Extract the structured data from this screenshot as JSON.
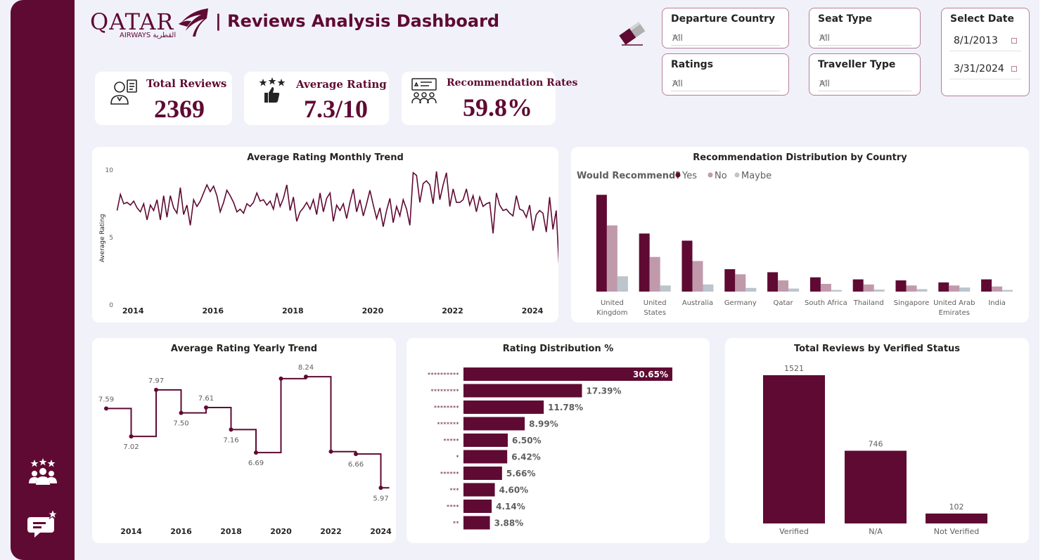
{
  "header": {
    "logo_text": "QATAR",
    "logo_sub": "AIRWAYS القطرية",
    "title": "| Reviews Analysis Dashboard"
  },
  "kpis": {
    "total_reviews": {
      "label": "Total Reviews",
      "value": "2369"
    },
    "average_rating": {
      "label": "Average Rating",
      "value": "7.3/10"
    },
    "recommendation": {
      "label": "Recommendation Rates",
      "value": "59.8%"
    }
  },
  "filters": {
    "departure_country": {
      "label": "Departure Country",
      "value": "All"
    },
    "seat_type": {
      "label": "Seat Type",
      "value": "All"
    },
    "ratings": {
      "label": "Ratings",
      "value": "All"
    },
    "traveller_type": {
      "label": "Traveller Type",
      "value": "All"
    },
    "date": {
      "label": "Select Date",
      "start": "8/1/2013",
      "end": "3/31/2024"
    }
  },
  "colors": {
    "brand": "#5f0a33",
    "no": "#c09aab",
    "maybe": "#bcc4cc",
    "background": "#f1f1f9"
  },
  "icons": [
    "users-icon",
    "star-thumb-icon",
    "recommend-board-icon",
    "eraser-icon",
    "team-stars-icon",
    "review-star-icon"
  ],
  "chart_data": [
    {
      "id": "monthly",
      "type": "line",
      "title": "Average Rating Monthly Trend",
      "ylabel": "Average Rating",
      "xlabel": "",
      "ylim": [
        0,
        10
      ],
      "yticks": [
        0,
        5,
        10
      ],
      "xticks": [
        "2014",
        "2016",
        "2018",
        "2020",
        "2022",
        "2024"
      ],
      "x_start": 2013.6,
      "x_step": 0.0833,
      "values": [
        7.0,
        8.2,
        7.5,
        7.6,
        7.4,
        7.7,
        7.2,
        6.9,
        7.5,
        6.3,
        7.4,
        7.0,
        7.8,
        6.3,
        8.1,
        6.5,
        8.1,
        7.2,
        6.8,
        8.7,
        6.7,
        7.4,
        5.9,
        7.8,
        7.3,
        7.7,
        8.3,
        8.9,
        8.4,
        8.8,
        8.1,
        6.9,
        7.6,
        8.5,
        8.1,
        7.6,
        6.9,
        7.1,
        6.8,
        7.5,
        7.3,
        7.6,
        8.3,
        7.7,
        7.8,
        7.4,
        7.7,
        7.1,
        8.3,
        7.3,
        7.9,
        8.9,
        7.0,
        8.0,
        6.2,
        6.9,
        7.2,
        7.6,
        7.1,
        7.8,
        6.7,
        8.3,
        6.9,
        7.9,
        8.3,
        6.2,
        7.4,
        7.0,
        7.5,
        6.4,
        7.6,
        8.6,
        6.9,
        7.8,
        6.6,
        7.5,
        8.5,
        7.4,
        6.4,
        7.2,
        5.8,
        7.0,
        7.9,
        6.1,
        7.3,
        6.6,
        7.8,
        7.1,
        5.9,
        9.8,
        9.6,
        7.6,
        9.0,
        9.2,
        8.9,
        7.5,
        9.9,
        7.8,
        8.9,
        9.8,
        7.3,
        8.6,
        7.6,
        7.6,
        7.8,
        8.6,
        7.4,
        8.1,
        6.9,
        8.0,
        7.3,
        7.5,
        7.6,
        5.3,
        8.3,
        7.4,
        7.0,
        7.1,
        6.8,
        6.6,
        8.1,
        7.1,
        7.0,
        6.5,
        7.4,
        5.5,
        6.7,
        7.0,
        6.8,
        5.4,
        8.0,
        5.6,
        7.0,
        2.1
      ],
      "point_markers": false
    },
    {
      "id": "country",
      "type": "bar",
      "title": "Recommendation Distribution by Country",
      "legend_title": "Would Recommend?",
      "legend_position": "top-left",
      "categories": [
        "United Kingdom",
        "United States",
        "Australia",
        "Germany",
        "Qatar",
        "South Africa",
        "Thailand",
        "Singapore",
        "United Arab Emirates",
        "India"
      ],
      "category_lines": [
        [
          "United",
          "Kingdom"
        ],
        [
          "United",
          "States"
        ],
        [
          "Australia"
        ],
        [
          "Germany"
        ],
        [
          "Qatar"
        ],
        [
          "South Africa"
        ],
        [
          "Thailand"
        ],
        [
          "Singapore"
        ],
        [
          "United Arab",
          "Emirates"
        ],
        [
          "India"
        ]
      ],
      "series": [
        {
          "name": "Yes",
          "values": [
            475,
            285,
            250,
            110,
            95,
            70,
            60,
            55,
            45,
            60
          ]
        },
        {
          "name": "No",
          "values": [
            325,
            170,
            150,
            85,
            55,
            38,
            35,
            30,
            30,
            25
          ]
        },
        {
          "name": "Maybe",
          "values": [
            75,
            30,
            35,
            18,
            15,
            8,
            10,
            12,
            20,
            8
          ]
        }
      ],
      "ylim": [
        0,
        500
      ]
    },
    {
      "id": "yearly",
      "type": "line",
      "title": "Average Rating Yearly Trend",
      "step": true,
      "x": [
        2013,
        2014,
        2015,
        2016,
        2017,
        2018,
        2019,
        2020,
        2021,
        2022,
        2023,
        2024
      ],
      "values": [
        7.59,
        7.02,
        7.97,
        7.5,
        7.61,
        7.16,
        6.69,
        8.2,
        8.24,
        6.71,
        6.66,
        5.97
      ],
      "labels": [
        "7.59",
        "7.02",
        "7.97",
        "7.50",
        "7.61",
        "7.16",
        "6.69",
        "",
        "8.24",
        "",
        "6.66",
        "5.97"
      ],
      "xticks": [
        "2014",
        "2016",
        "2018",
        "2020",
        "2022",
        "2024"
      ],
      "ylim": [
        5.5,
        8.6
      ]
    },
    {
      "id": "rating_dist",
      "type": "bar",
      "orientation": "horizontal",
      "title": "Rating Distribution %",
      "categories": [
        "**********",
        "*********",
        "********",
        "*******",
        "*****",
        "*",
        "******",
        "***",
        "****",
        "**"
      ],
      "values": [
        30.65,
        17.39,
        11.78,
        8.99,
        6.5,
        6.42,
        5.66,
        4.6,
        4.14,
        3.88
      ],
      "labels": [
        "30.65%",
        "17.39%",
        "11.78%",
        "8.99%",
        "6.50%",
        "6.42%",
        "5.66%",
        "4.60%",
        "4.14%",
        "3.88%"
      ],
      "xlim": [
        0,
        30.65
      ]
    },
    {
      "id": "verified",
      "type": "bar",
      "title": "Total Reviews by Verified Status",
      "categories": [
        "Verified",
        "N/A",
        "Not Verified"
      ],
      "values": [
        1521,
        746,
        102
      ],
      "labels": [
        "1521",
        "746",
        "102"
      ],
      "ylim": [
        0,
        1521
      ]
    }
  ]
}
